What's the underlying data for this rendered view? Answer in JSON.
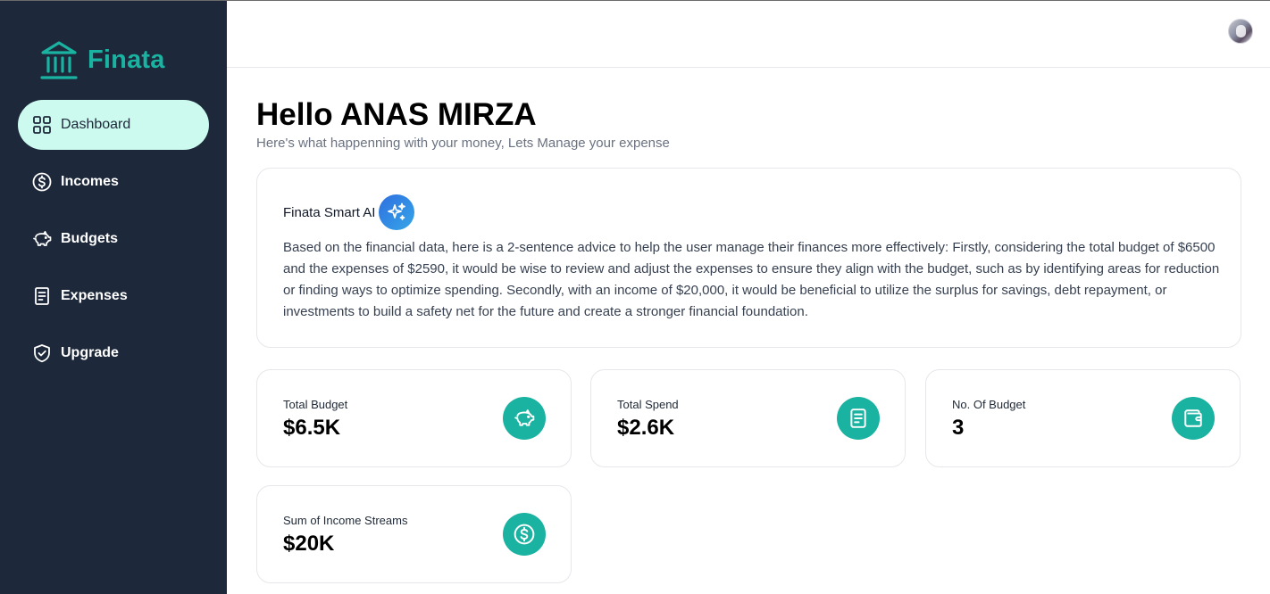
{
  "brand": {
    "name": "Finata",
    "logo_icon": "bank-icon",
    "accent": "#1ab2a0"
  },
  "sidebar": {
    "background": "#1d283a",
    "items": [
      {
        "label": "Dashboard",
        "icon": "grid-icon",
        "active": true
      },
      {
        "label": "Incomes",
        "icon": "dollar-circle-icon"
      },
      {
        "label": "Budgets",
        "icon": "piggy-bank-icon"
      },
      {
        "label": "Expenses",
        "icon": "receipt-icon"
      },
      {
        "label": "Upgrade",
        "icon": "shield-check-icon"
      }
    ]
  },
  "header": {
    "avatar": "user-avatar"
  },
  "main": {
    "greeting": "Hello ANAS MIRZA",
    "subtitle": "Here's what happenning with your money, Lets Manage your expense",
    "ai_card": {
      "title": "Finata Smart AI",
      "icon": "sparkles-icon",
      "advice": "Based on the financial data, here is a 2-sentence advice to help the user manage their finances more effectively: Firstly, considering the total budget of $6500 and the expenses of $2590, it would be wise to review and adjust the expenses to ensure they align with the budget, such as by identifying areas for reduction or finding ways to optimize spending. Secondly, with an income of $20,000, it would be beneficial to utilize the surplus for savings, debt repayment, or investments to build a safety net for the future and create a stronger financial foundation."
    },
    "stats": [
      {
        "label": "Total Budget",
        "value": "$6.5K",
        "icon": "piggy-bank-icon"
      },
      {
        "label": "Total Spend",
        "value": "$2.6K",
        "icon": "receipt-icon"
      },
      {
        "label": "No. Of Budget",
        "value": "3",
        "icon": "wallet-icon"
      },
      {
        "label": "Sum of Income Streams",
        "value": "$20K",
        "icon": "dollar-circle-icon"
      }
    ]
  }
}
